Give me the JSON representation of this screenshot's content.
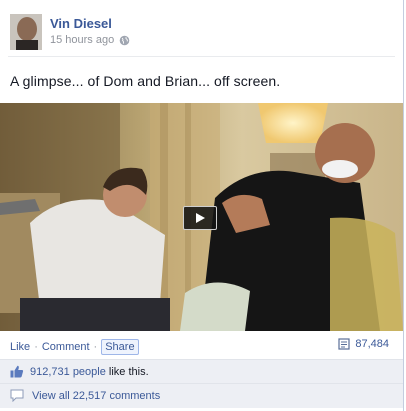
{
  "post": {
    "author": "Vin Diesel",
    "timestamp": "15 hours ago",
    "privacy_icon": "globe-icon",
    "message": "A glimpse... of Dom and Brian... off screen.",
    "video": {
      "play_icon": "play-icon"
    }
  },
  "actions": {
    "like_label": "Like",
    "comment_label": "Comment",
    "share_label": "Share",
    "separator": "·",
    "views_icon": "views-icon",
    "views_count": "87,484"
  },
  "likes": {
    "icon": "thumbs-up-icon",
    "count": "912,731 people",
    "suffix": "like this."
  },
  "comments": {
    "icon": "comment-icon",
    "label": "View all 22,517 comments"
  },
  "colors": {
    "link": "#3b5998",
    "meta": "#90949c",
    "footer_bg": "#edeff4"
  }
}
